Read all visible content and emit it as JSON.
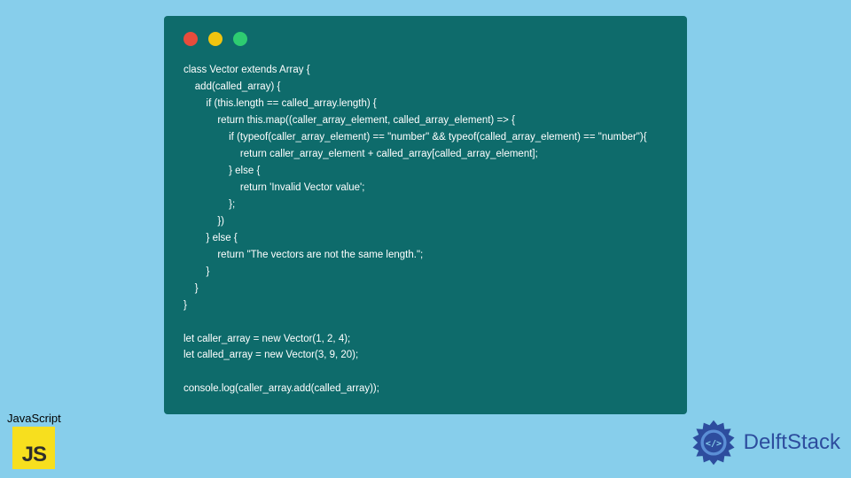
{
  "code": {
    "lines": [
      "class Vector extends Array {",
      "    add(called_array) {",
      "        if (this.length == called_array.length) {",
      "            return this.map((caller_array_element, called_array_element) => {",
      "                if (typeof(caller_array_element) == \"number\" && typeof(called_array_element) == \"number\"){",
      "                    return caller_array_element + called_array[called_array_element];",
      "                } else {",
      "                    return 'Invalid Vector value';",
      "                };",
      "            })",
      "        } else {",
      "            return \"The vectors are not the same length.\";",
      "        }",
      "    }",
      "}",
      "",
      "let caller_array = new Vector(1, 2, 4);",
      "let called_array = new Vector(3, 9, 20);",
      "",
      "console.log(caller_array.add(called_array));"
    ]
  },
  "js_badge": {
    "label": "JavaScript",
    "logo_text": "JS"
  },
  "delft": {
    "brand": "DelftStack"
  },
  "colors": {
    "page_bg": "#87ceeb",
    "editor_bg": "#0e6b6b",
    "js_yellow": "#f7df1e",
    "delft_blue": "#2d4d9e"
  }
}
